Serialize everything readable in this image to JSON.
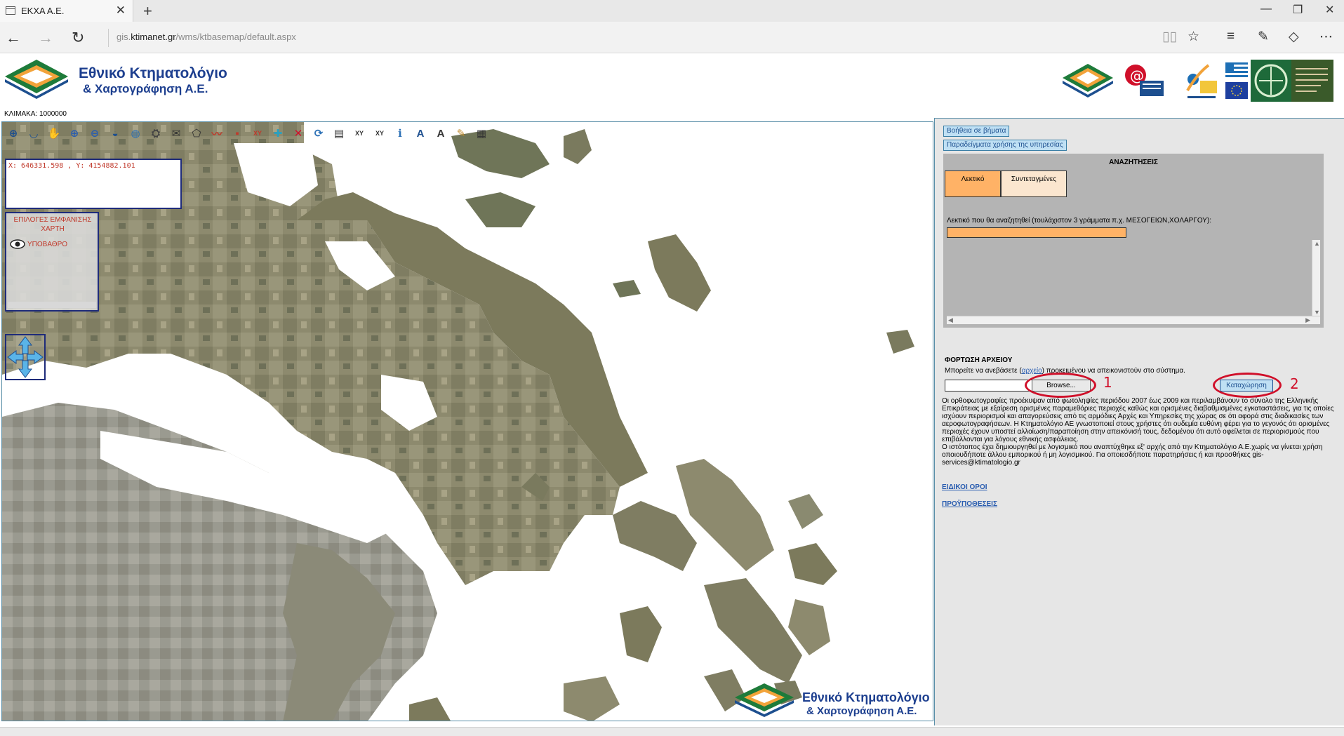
{
  "browser": {
    "tab_title": "ΕΚΧΑ Α.Ε.",
    "tab_close": "✕",
    "new_tab": "+",
    "window_controls": [
      "—",
      "❐",
      "✕"
    ],
    "url_prefix": "gis.",
    "url_domain": "ktimanet.gr",
    "url_path": "/wms/ktbasemap/default.aspx",
    "back_icon": "←",
    "forward_icon": "→",
    "refresh_icon": "↻",
    "toolbar_icons": [
      "reading-view-icon",
      "favorite-star-icon",
      "hub-icon",
      "web-note-icon",
      "share-icon",
      "more-icon"
    ]
  },
  "header": {
    "logo_line1": "Εθνικό Κτηματολόγιο",
    "logo_line2": "& Χαρτογράφηση Α.Ε.",
    "scale_label": "ΚΛΙΜΑΚΑ: 1000000"
  },
  "map": {
    "coord_text": "X: 646331.598 , Y: 4154882.101",
    "layers_title": "ΕΠΙΛΟΓΕΣ ΕΜΦΑΝΙΣΗΣ ΧΑΡΤΗ",
    "layers_item": "ΥΠΟΒΑΘΡΟ",
    "tools": [
      {
        "name": "zoom-in-tool-icon",
        "glyph": "⊕",
        "color": "#1d4f8f"
      },
      {
        "name": "zoom-extent-tool-icon",
        "glyph": "◡",
        "color": "#1d4f8f"
      },
      {
        "name": "pan-hand-tool-icon",
        "glyph": "✋",
        "color": "#8a6a2a"
      },
      {
        "name": "zoom-box-in-icon",
        "glyph": "⊕",
        "color": "#2a5db0"
      },
      {
        "name": "zoom-box-out-icon",
        "glyph": "⊖",
        "color": "#2a5db0"
      },
      {
        "name": "zoom-previous-icon",
        "glyph": "◒",
        "color": "#1d4f8f"
      },
      {
        "name": "full-extent-globe-icon",
        "glyph": "◍",
        "color": "#2a6fb5"
      },
      {
        "name": "layers-tool-icon",
        "glyph": "⛭",
        "color": "#444"
      },
      {
        "name": "envelope-tool-icon",
        "glyph": "✉",
        "color": "#333"
      },
      {
        "name": "polygon-tool-icon",
        "glyph": "⬠",
        "color": "#333"
      },
      {
        "name": "measure-line-icon",
        "glyph": "〰",
        "color": "#c0392b"
      },
      {
        "name": "point-tool-icon",
        "glyph": "▪",
        "color": "#c0392b"
      },
      {
        "name": "coordinate-xy-icon",
        "glyph": "XY",
        "color": "#c0392b"
      },
      {
        "name": "pick-tool-icon",
        "glyph": "✚",
        "color": "#2aa0c0"
      },
      {
        "name": "clear-tool-icon",
        "glyph": "✕",
        "color": "#d0102a"
      },
      {
        "name": "refresh-map-icon",
        "glyph": "⟳",
        "color": "#2a6fb5"
      },
      {
        "name": "document-tool-icon",
        "glyph": "▤",
        "color": "#333"
      },
      {
        "name": "xy-table-icon",
        "glyph": "XY",
        "color": "#333"
      },
      {
        "name": "xy-goto-icon",
        "glyph": "XY",
        "color": "#333"
      },
      {
        "name": "info-tool-icon",
        "glyph": "ℹ",
        "color": "#2a6fb5"
      },
      {
        "name": "label-a-icon",
        "glyph": "A",
        "color": "#1d4f8f"
      },
      {
        "name": "text-a-icon",
        "glyph": "A",
        "color": "#333"
      },
      {
        "name": "print-tool-icon",
        "glyph": "✎",
        "color": "#c08a2a"
      },
      {
        "name": "window-tool-icon",
        "glyph": "▦",
        "color": "#333"
      }
    ]
  },
  "side": {
    "help_link": "Βοήθεια σε βήματα",
    "examples_link": "Παραδείγματα χρήσης της υπηρεσίας",
    "search_title": "ΑΝΑΖΗΤΗΣΕΙΣ",
    "tab_text": "Λεκτικό",
    "tab_coords": "Συντεταγμένες",
    "search_hint": "Λεκτικό που θα αναζητηθεί (τουλάχιστον 3 γράμματα π.χ. ΜΕΣΟΓΕΙΩΝ,ΧΟΛΑΡΓΟΥ):",
    "upload_title": "ΦΟΡΤΩΣΗ ΑΡΧΕΙΟΥ",
    "upload_desc_pre": "Μπορείτε να ανεβάσετε (",
    "upload_desc_link": "αρχείο",
    "upload_desc_post": ") προκειμένου να απεικονιστούν στο σύστημα.",
    "browse_label": "Browse...",
    "submit_label": "Καταχώρηση",
    "annot_1": "1",
    "annot_2": "2",
    "disclaimer_1": "Οι ορθοφωτογραφίες προέκυψαν από φωτοληψίες περιόδου 2007 έως 2009 και περιλαμβάνουν το σύνολο της Ελληνικής Επικράτειας με εξαίρεση ορισμένες παραμεθόριες περιοχές καθώς και ορισμένες διαβαθμισμένες εγκαταστάσεις, για τις οποίες ισχύουν περιορισμοί και απαγορεύσεις από τις αρμόδιες Αρχές και Υπηρεσίες της χώρας σε ότι αφορά στις διαδικασίες των αεροφωτογραφήσεων. Η Κτηματολόγιο ΑΕ γνωστοποιεί στους χρήστες ότι ουδεμία ευθύνη φέρει για το γεγονός ότι ορισμένες περιοχές έχουν υποστεί αλλοίωση/παραποίηση στην απεικόνισή τους, δεδομένου ότι αυτό οφείλεται σε περιορισμούς που επιβάλλονται για λόγους εθνικής ασφάλειας.",
    "disclaimer_2": "Ο ιστότοπος έχει δημιουργηθεί με λογισμικό που αναπτύχθηκε εξ' αρχής από την Κτηματολόγιο Α.Ε.χωρίς να γίνεται χρήση οποιουδήποτε άλλου εμπορικού ή μη λογισμικού. Για οποιεσδήποτε παρατηρήσεις ή και προσθήκες gis-services@ktimatologio.gr",
    "terms_link": "ΕΙΔΙΚΟΙ ΟΡΟΙ",
    "conditions_link": "ΠΡΟΫΠΟΘΕΣΕΙΣ"
  }
}
